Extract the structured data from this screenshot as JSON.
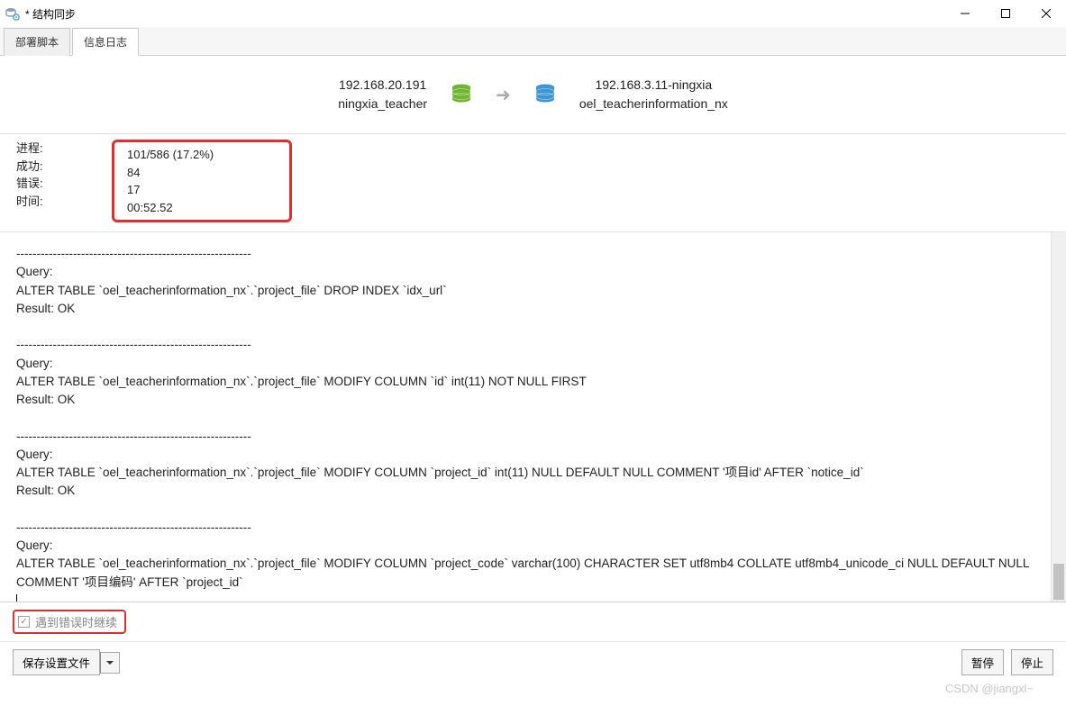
{
  "window": {
    "title": "* 结构同步"
  },
  "tabs": {
    "deploy": "部署脚本",
    "log": "信息日志"
  },
  "connection": {
    "source": {
      "ip": "192.168.20.191",
      "db": "ningxia_teacher"
    },
    "target": {
      "ip": "192.168.3.11-ningxia",
      "db": "oel_teacherinformation_nx"
    }
  },
  "stats": {
    "labels": {
      "process": "进程:",
      "success": "成功:",
      "error": "错误:",
      "time": "时间:"
    },
    "values": {
      "process": "101/586 (17.2%)",
      "success": "84",
      "error": "17",
      "time": "00:52.52"
    }
  },
  "log_text": "----------------------------------------------------------\nQuery:\nALTER TABLE `oel_teacherinformation_nx`.`project_file` DROP INDEX `idx_url`\nResult: OK\n\n----------------------------------------------------------\nQuery:\nALTER TABLE `oel_teacherinformation_nx`.`project_file` MODIFY COLUMN `id` int(11) NOT NULL FIRST\nResult: OK\n\n----------------------------------------------------------\nQuery:\nALTER TABLE `oel_teacherinformation_nx`.`project_file` MODIFY COLUMN `project_id` int(11) NULL DEFAULT NULL COMMENT '项目id' AFTER `notice_id`\nResult: OK\n\n----------------------------------------------------------\nQuery:\nALTER TABLE `oel_teacherinformation_nx`.`project_file` MODIFY COLUMN `project_code` varchar(100) CHARACTER SET utf8mb4 COLLATE utf8mb4_unicode_ci NULL DEFAULT NULL COMMENT '项目编码' AFTER `project_id`",
  "checkbox": {
    "label": "遇到错误时继续"
  },
  "footer": {
    "save": "保存设置文件",
    "pause": "暂停",
    "stop": "停止"
  },
  "watermark": "CSDN @jiangxl~"
}
